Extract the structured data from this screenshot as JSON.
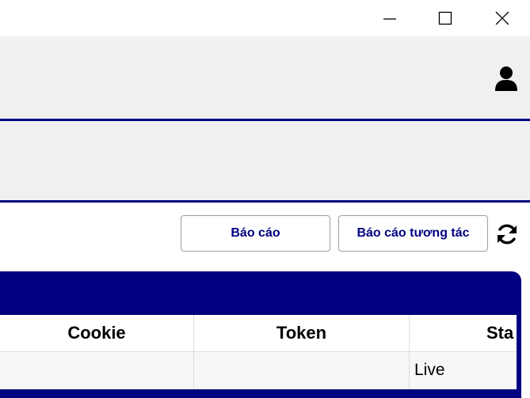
{
  "window": {
    "controls": [
      "minimize-icon",
      "maximize-icon",
      "close-icon"
    ]
  },
  "header": {
    "user_icon": "user-icon"
  },
  "toolbar": {
    "report_label": "Báo cáo",
    "interaction_report_label": "Báo cáo tương tác",
    "refresh_icon": "refresh-icon"
  },
  "table": {
    "columns": [
      "Cookie",
      "Token",
      "Sta"
    ],
    "rows": [
      {
        "cookie": "",
        "token": "",
        "status": "Live"
      }
    ]
  },
  "colors": {
    "accent": "#000080",
    "header_bg": "#f0f0f0"
  }
}
